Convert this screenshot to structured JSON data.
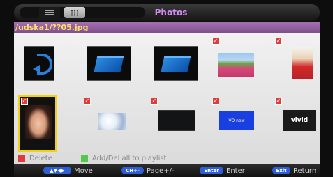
{
  "header": {
    "title": "Photos"
  },
  "path": "/udska1/??05.jpg",
  "legend": {
    "delete_label": "Delete",
    "add_label": "Add/Del all to playlist",
    "delete_color": "#e03b3b",
    "add_color": "#52c94a"
  },
  "nav": [
    {
      "key": "▲▼◀▶",
      "label": "Move"
    },
    {
      "key": "CH+-",
      "label": "Page+/-"
    },
    {
      "key": "Enter",
      "label": "Enter"
    },
    {
      "key": "Exit",
      "label": "Return"
    }
  ],
  "thumbnails": {
    "row1": [
      {
        "kind": "up-folder",
        "checked": false
      },
      {
        "kind": "folder",
        "checked": false
      },
      {
        "kind": "folder",
        "checked": false
      },
      {
        "kind": "photo-flowers",
        "checked": true
      },
      {
        "kind": "photo-woman-red",
        "checked": true
      }
    ],
    "row2": [
      {
        "kind": "photo-woman-face",
        "checked": true,
        "selected": true
      },
      {
        "kind": "photo-white-flowers",
        "checked": true
      },
      {
        "kind": "photo-dark",
        "checked": true
      },
      {
        "kind": "photo-blue-logo",
        "checked": true,
        "logo_text": "VO new"
      },
      {
        "kind": "photo-vivid",
        "checked": true,
        "logo_text": "vivid"
      }
    ]
  },
  "colors": {
    "title": "#d18cf0",
    "path": "#ffe06a",
    "path_bar": "#8f5c9b",
    "selection": "#f2d20c",
    "key_pill": "#2d5fd6"
  }
}
